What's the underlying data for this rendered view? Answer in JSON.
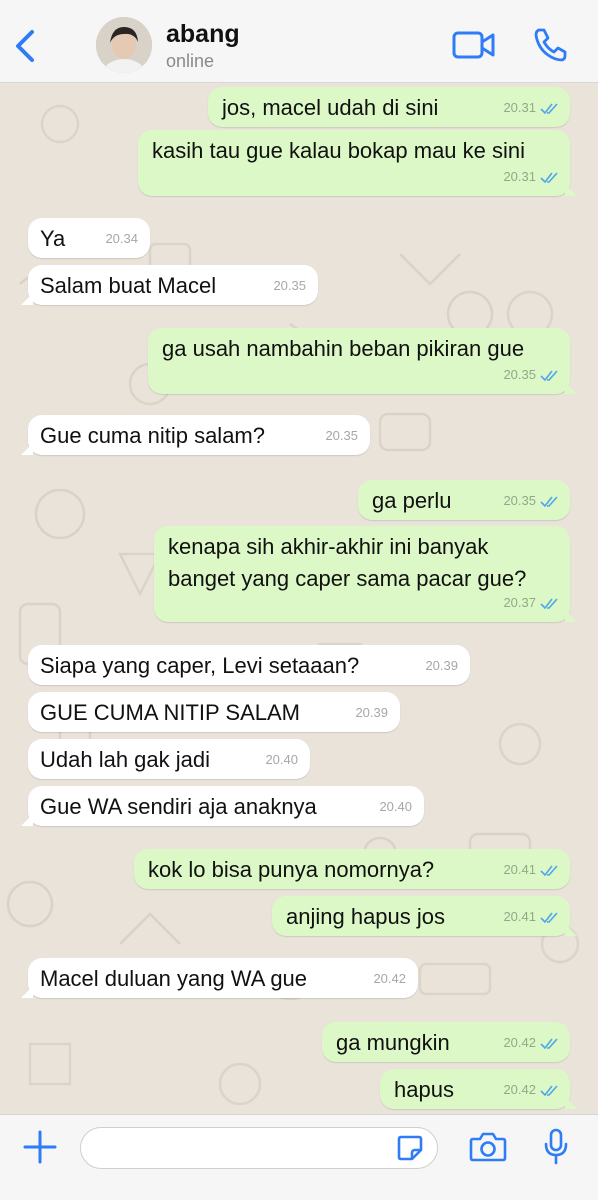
{
  "header": {
    "name": "abang",
    "status": "online"
  },
  "colors": {
    "accent": "#2e7cf6",
    "outgoing_bubble": "#dcf8c6",
    "incoming_bubble": "#ffffff",
    "read_ticks": "#4fa6e8"
  },
  "messages": [
    {
      "dir": "out",
      "text": "jos, macel udah di sini",
      "time": "20.31",
      "ticks": "read"
    },
    {
      "dir": "out",
      "text": "kasih tau gue kalau bokap mau ke sini",
      "time": "20.31",
      "ticks": "read"
    },
    {
      "dir": "in",
      "text": "Ya",
      "time": "20.34"
    },
    {
      "dir": "in",
      "text": "Salam buat Macel",
      "time": "20.35"
    },
    {
      "dir": "out",
      "text": "ga usah nambahin beban pikiran gue",
      "time": "20.35",
      "ticks": "read"
    },
    {
      "dir": "in",
      "text": "Gue cuma nitip salam?",
      "time": "20.35"
    },
    {
      "dir": "out",
      "text": "ga perlu",
      "time": "20.35",
      "ticks": "read"
    },
    {
      "dir": "out",
      "text": "kenapa sih akhir-akhir ini banyak",
      "text2": "banget yang caper sama pacar gue?",
      "time": "20.37",
      "ticks": "read"
    },
    {
      "dir": "in",
      "text": "Siapa yang caper, Levi setaaan?",
      "time": "20.39"
    },
    {
      "dir": "in",
      "text": "GUE CUMA NITIP SALAM",
      "time": "20.39"
    },
    {
      "dir": "in",
      "text": "Udah lah gak jadi",
      "time": "20.40"
    },
    {
      "dir": "in",
      "text": "Gue WA sendiri aja anaknya",
      "time": "20.40"
    },
    {
      "dir": "out",
      "text": "kok lo bisa punya nomornya?",
      "time": "20.41",
      "ticks": "read"
    },
    {
      "dir": "out",
      "text": "anjing hapus jos",
      "time": "20.41",
      "ticks": "read"
    },
    {
      "dir": "in",
      "text": "Macel duluan yang WA gue",
      "time": "20.42"
    },
    {
      "dir": "out",
      "text": "ga mungkin",
      "time": "20.42",
      "ticks": "read"
    },
    {
      "dir": "out",
      "text": "hapus",
      "time": "20.42",
      "ticks": "read"
    }
  ],
  "icons": {
    "back": "chevron-left-icon",
    "video": "video-camera-icon",
    "call": "phone-icon",
    "attach": "plus-icon",
    "sticker": "sticker-icon",
    "camera": "camera-icon",
    "mic": "microphone-icon"
  }
}
